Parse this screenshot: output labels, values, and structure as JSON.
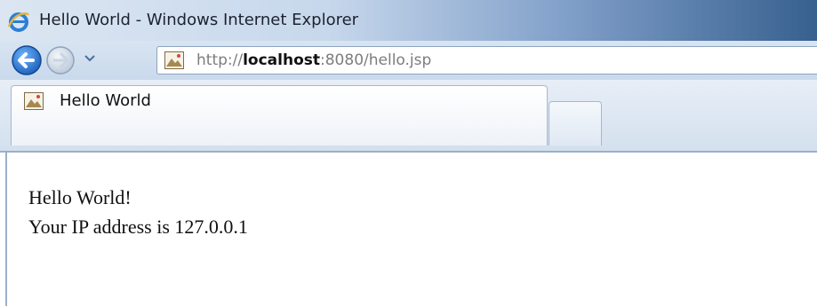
{
  "window": {
    "title": "Hello World - Windows Internet Explorer"
  },
  "navbar": {
    "url_prefix": "http://",
    "url_host": "localhost",
    "url_rest": ":8080/hello.jsp"
  },
  "tabs": [
    {
      "label": "Hello World",
      "active": true
    }
  ],
  "page": {
    "line1": "Hello World!",
    "line2": "Your IP address is 127.0.0.1"
  },
  "colors": {
    "title_bar_accent": "#37608f",
    "back_button": "#1f6fd1",
    "url_host": "#111111",
    "url_dim": "#7d7d7d"
  },
  "icons": {
    "browser": "ie-logo-icon",
    "back": "back-arrow-icon",
    "forward": "forward-arrow-icon",
    "history": "chevron-down-icon",
    "favicon": "page-favicon-icon"
  }
}
